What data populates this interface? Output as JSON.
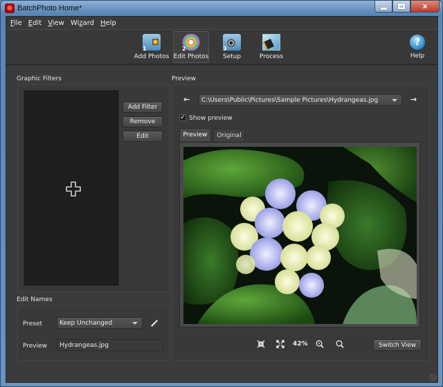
{
  "window": {
    "title": "BatchPhoto Home*",
    "controls": {
      "minimize": "minimize",
      "maximize": "maximize",
      "close": "x"
    }
  },
  "menu": [
    {
      "label": "File",
      "accel": "F",
      "rest": "ile"
    },
    {
      "label": "Edit",
      "accel": "E",
      "rest": "dit"
    },
    {
      "label": "View",
      "accel": "V",
      "rest": "iew"
    },
    {
      "label": "Wizard",
      "pre": "Wi",
      "accel": "z",
      "rest": "ard"
    },
    {
      "label": "Help",
      "accel": "H",
      "rest": "elp"
    }
  ],
  "toolbar": {
    "items": [
      {
        "label": "Add Photos",
        "step": "1",
        "icon": "add-photos-icon",
        "active": false
      },
      {
        "label": "Edit Photos",
        "step": "2",
        "icon": "edit-photos-icon",
        "active": true
      },
      {
        "label": "Setup",
        "step": "3",
        "icon": "setup-icon",
        "active": false
      },
      {
        "label": "Process",
        "step": "",
        "icon": "process-icon",
        "active": false
      }
    ],
    "help": {
      "label": "Help",
      "glyph": "?"
    }
  },
  "graphic_filters": {
    "title": "Graphic Filters",
    "add_filter": "Add Filter",
    "remove": "Remove",
    "edit": "Edit",
    "empty_icon": "add-plus-icon"
  },
  "edit_names": {
    "title": "Edit Names",
    "preset_label": "Preset",
    "preset_value": "Keep Unchanged",
    "preview_label": "Preview",
    "preview_value": "Hydrangeas.jpg"
  },
  "preview": {
    "title": "Preview",
    "path": "C:\\Users\\Public\\Pictures\\Sample Pictures\\Hydrangeas.jpg",
    "prev_glyph": "←",
    "next_glyph": "→",
    "show_preview_label": "Show preview",
    "show_preview_checked": true,
    "check_glyph": "✓",
    "tabs": [
      {
        "label": "Preview",
        "active": true
      },
      {
        "label": "Original",
        "active": false
      }
    ],
    "image_subject": "Hydrangea flower with green leaves",
    "zoom_level": "42%",
    "switch_view": "Switch View"
  }
}
